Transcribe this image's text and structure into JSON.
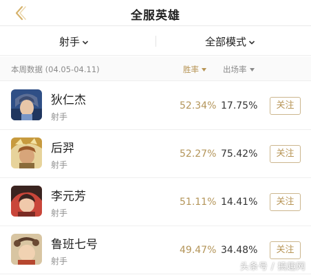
{
  "header": {
    "title": "全服英雄",
    "back_icon": "back-arrow-icon"
  },
  "filters": {
    "role": "射手",
    "mode": "全部模式"
  },
  "subheader": {
    "week": "本周数据 (04.05-04.11)",
    "sort_win": "胜率",
    "sort_rate": "出场率"
  },
  "colors": {
    "accent": "#b79455",
    "text": "#222222",
    "muted": "#8f8f8f"
  },
  "heroes": [
    {
      "name": "狄仁杰",
      "role": "射手",
      "win_rate": "52.34%",
      "pick_rate": "17.75%",
      "follow": "关注"
    },
    {
      "name": "后羿",
      "role": "射手",
      "win_rate": "52.27%",
      "pick_rate": "75.42%",
      "follow": "关注"
    },
    {
      "name": "李元芳",
      "role": "射手",
      "win_rate": "51.11%",
      "pick_rate": "14.41%",
      "follow": "关注"
    },
    {
      "name": "鲁班七号",
      "role": "射手",
      "win_rate": "49.47%",
      "pick_rate": "34.48%",
      "follow": "关注"
    }
  ],
  "watermark": "头条号 / 搞趣网"
}
